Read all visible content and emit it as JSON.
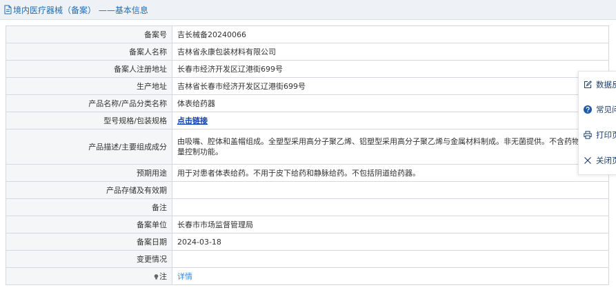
{
  "header": {
    "title": "境内医疗器械（备案） ——基本信息",
    "icon": "document-icon"
  },
  "rows": [
    {
      "key": "record_no",
      "label": "备案号",
      "value": "吉长械备20240066"
    },
    {
      "key": "applicant_name",
      "label": "备案人名称",
      "value": "吉林省永康包装材料有限公司"
    },
    {
      "key": "applicant_address",
      "label": "备案人注册地址",
      "value": "长春市经济开发区辽港街699号"
    },
    {
      "key": "production_address",
      "label": "生产地址",
      "value": "吉林省长春市经济开发区辽港街699号"
    },
    {
      "key": "product_name",
      "label": "产品名称/产品分类名称",
      "value": "体表给药器"
    },
    {
      "key": "model_spec",
      "label": "型号规格/包装规格",
      "value": "点击链接"
    },
    {
      "key": "description",
      "label": "产品描述/主要组成成分",
      "value": "由吸嘴、腔体和盖帽组成。全塑型采用高分子聚乙烯、铝塑型采用高分子聚乙烯与金属材料制成。非无菌提供。不含药物。不具量控制功能。"
    },
    {
      "key": "intended_use",
      "label": "预期用途",
      "value": "用于对患者体表给药。不用于皮下给药和静脉给药。不包括阴道给药器。"
    },
    {
      "key": "storage",
      "label": "产品存储及有效期",
      "value": ""
    },
    {
      "key": "remarks",
      "label": "备注",
      "value": ""
    },
    {
      "key": "record_unit",
      "label": "备案单位",
      "value": "长春市市场监督管理局"
    },
    {
      "key": "record_date",
      "label": "备案日期",
      "value": "2024-03-18"
    },
    {
      "key": "change_info",
      "label": "变更情况",
      "value": ""
    },
    {
      "key": "note",
      "label": "注",
      "value": "详情"
    }
  ],
  "side_panel": {
    "items": [
      {
        "label": "数据反",
        "icon": "edit-icon"
      },
      {
        "label": "常见问",
        "icon": "help-icon"
      },
      {
        "label": "打印页",
        "icon": "print-icon"
      },
      {
        "label": "关闭页",
        "icon": "close-icon"
      }
    ]
  },
  "colors": {
    "accent": "#1f6db5",
    "link": "#0b3db0",
    "detail_link": "#3a8ad6",
    "label_bg": "#f5f6f8",
    "border": "#d4d9df",
    "header_bg": "#eef1f5"
  }
}
